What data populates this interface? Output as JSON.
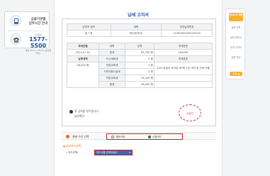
{
  "left_panel": {
    "item1_title": "금융기관별",
    "item1_sub": "납부시간 안내",
    "item2_caption": "고객센터",
    "item2_phone": "1577-5500",
    "item2_note": "평일 09:00~18:00 (공휴일 제외)"
  },
  "main": {
    "title": "납세 고지서",
    "table1": {
      "headers": [
        "납부자 정보",
        "세목",
        "전자납부번호"
      ],
      "row": [
        "홍 * 동",
        "재산세(토지)",
        "11560000000000000"
      ]
    },
    "table2": {
      "left": [
        {
          "label": "과세년월",
          "value": "2012.07.01"
        },
        {
          "label": "납부세액",
          "value": "96,600 원"
        }
      ],
      "items": [
        {
          "label": "세목",
          "amount": "금액"
        },
        {
          "label": "본세",
          "amount": "63,700 원"
        },
        {
          "label": "도시계획세",
          "amount": "0 원"
        },
        {
          "label": "지방교육세",
          "amount": "0 원"
        },
        {
          "label": "지역자원시설세",
          "amount": "0 원"
        },
        {
          "label": "지방교육세",
          "amount": "26,440 원"
        },
        {
          "label": "합계",
          "amount": "96,600 원"
        }
      ],
      "right_header1": "과세표준",
      "right_value1": "180000",
      "right_header2": "과세표준",
      "right_value2": "2047호빌라 토지분 제7층 1호 대지 및 주택 건물"
    },
    "notice_line1": "위 금액을 영수합니다.",
    "notice_line2": "납부확인",
    "stamp": "수납인"
  },
  "payment": {
    "label": "결제 수단 선택",
    "options": [
      "계좌이체",
      "신용카드"
    ],
    "selected_index": 1,
    "method_title": "납부카드선택",
    "card_label": "카드선택",
    "card_selected": "카드사를 선택하세요"
  },
  "right_panel": {
    "head": "QUICK 메뉴",
    "items": [
      "납부 내역",
      "납부 확인서",
      "전자 고지서",
      "납부 안내"
    ],
    "top_button": "TOP ▲"
  },
  "colors": {
    "accent_blue": "#1c4fa0",
    "highlight_red": "#c8202c",
    "orange": "#e86a1c",
    "quick_yellow": "#f2b233"
  }
}
